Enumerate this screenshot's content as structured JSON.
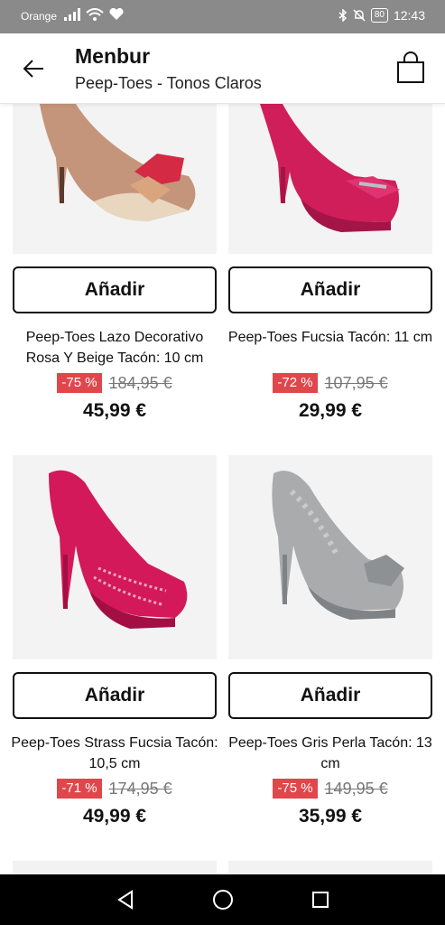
{
  "status": {
    "carrier": "Orange",
    "battery": "80",
    "time": "12:43"
  },
  "header": {
    "title": "Menbur",
    "subtitle": "Peep-Toes - Tonos Claros"
  },
  "products": [
    {
      "name": "Peep-Toes Lazo Decorativo Rosa Y Beige Tacón: 10 cm",
      "discount": "-75 %",
      "old_price": "184,95 €",
      "price": "45,99 €",
      "add_label": "Añadir",
      "colors": {
        "main": "#c4957a",
        "accent": "#d42a43",
        "toe": "#e8d6bf"
      }
    },
    {
      "name": "Peep-Toes Fucsia Tacón: 11 cm",
      "discount": "-72 %",
      "old_price": "107,95 €",
      "price": "29,99 €",
      "add_label": "Añadir",
      "colors": {
        "main": "#d01e5a",
        "accent": "#b8c0c4"
      }
    },
    {
      "name": "Peep-Toes Strass Fucsia Tacón: 10,5 cm",
      "discount": "-71 %",
      "old_price": "174,95 €",
      "price": "49,99 €",
      "add_label": "Añadir",
      "colors": {
        "main": "#d3195a",
        "accent": "#e8a8b8"
      }
    },
    {
      "name": "Peep-Toes Gris Perla Tacón: 13 cm",
      "discount": "-75 %",
      "old_price": "149,95 €",
      "price": "35,99 €",
      "add_label": "Añadir",
      "colors": {
        "main": "#a9abad",
        "accent": "#7f8386"
      }
    }
  ]
}
